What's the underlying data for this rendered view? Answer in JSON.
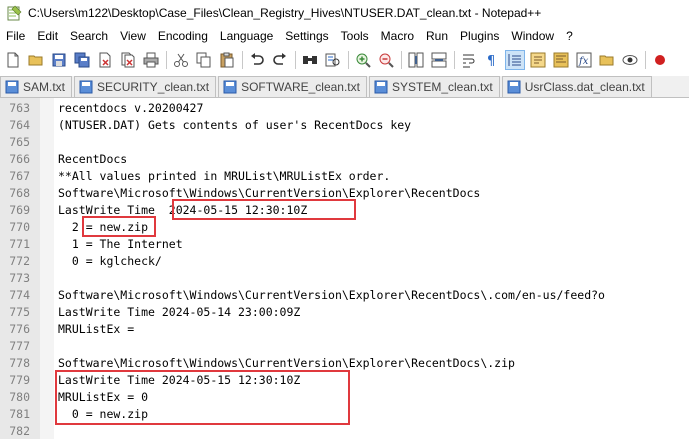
{
  "window": {
    "title": "C:\\Users\\m122\\Desktop\\Case_Files\\Clean_Registry_Hives\\NTUSER.DAT_clean.txt - Notepad++"
  },
  "menu": [
    "File",
    "Edit",
    "Search",
    "View",
    "Encoding",
    "Language",
    "Settings",
    "Tools",
    "Macro",
    "Run",
    "Plugins",
    "Window",
    "?"
  ],
  "toolbar": {
    "icons": [
      "new-icon",
      "open-icon",
      "save-icon",
      "save-all-icon",
      "close-icon",
      "close-all-icon",
      "print-icon",
      "cut-icon",
      "copy-icon",
      "paste-icon",
      "undo-icon",
      "redo-icon",
      "find-icon",
      "replace-icon",
      "zoom-in-icon",
      "zoom-out-icon",
      "sync-v-icon",
      "sync-h-icon",
      "word-wrap-icon",
      "show-all-chars-icon",
      "indent-guide-icon",
      "udl-icon",
      "doc-map-icon",
      "function-list-icon",
      "folder-workspace-icon",
      "monitor-icon",
      "record-macro-icon"
    ]
  },
  "tabs": [
    {
      "label": "SAM.txt"
    },
    {
      "label": "SECURITY_clean.txt"
    },
    {
      "label": "SOFTWARE_clean.txt"
    },
    {
      "label": "SYSTEM_clean.txt"
    },
    {
      "label": "UsrClass.dat_clean.txt"
    }
  ],
  "editor": {
    "lines": [
      {
        "num": "763",
        "text": "recentdocs v.20200427"
      },
      {
        "num": "764",
        "text": "(NTUSER.DAT) Gets contents of user's RecentDocs key"
      },
      {
        "num": "765",
        "text": ""
      },
      {
        "num": "766",
        "text": "RecentDocs"
      },
      {
        "num": "767",
        "text": "**All values printed in MRUList\\MRUListEx order."
      },
      {
        "num": "768",
        "text": "Software\\Microsoft\\Windows\\CurrentVersion\\Explorer\\RecentDocs"
      },
      {
        "num": "769",
        "text": "LastWrite Time  2024-05-15 12:30:10Z"
      },
      {
        "num": "770",
        "text": "  2 = new.zip"
      },
      {
        "num": "771",
        "text": "  1 = The Internet"
      },
      {
        "num": "772",
        "text": "  0 = kglcheck/"
      },
      {
        "num": "773",
        "text": ""
      },
      {
        "num": "774",
        "text": "Software\\Microsoft\\Windows\\CurrentVersion\\Explorer\\RecentDocs\\.com/en-us/feed?o"
      },
      {
        "num": "775",
        "text": "LastWrite Time 2024-05-14 23:00:09Z"
      },
      {
        "num": "776",
        "text": "MRUListEx ="
      },
      {
        "num": "777",
        "text": ""
      },
      {
        "num": "778",
        "text": "Software\\Microsoft\\Windows\\CurrentVersion\\Explorer\\RecentDocs\\.zip"
      },
      {
        "num": "779",
        "text": "LastWrite Time 2024-05-15 12:30:10Z"
      },
      {
        "num": "780",
        "text": "MRUListEx = 0"
      },
      {
        "num": "781",
        "text": "  0 = new.zip"
      },
      {
        "num": "782",
        "text": ""
      }
    ]
  },
  "colors": {
    "annotation": "#e0393e",
    "gutter": "#e8e8e8",
    "line_number": "#808080"
  }
}
